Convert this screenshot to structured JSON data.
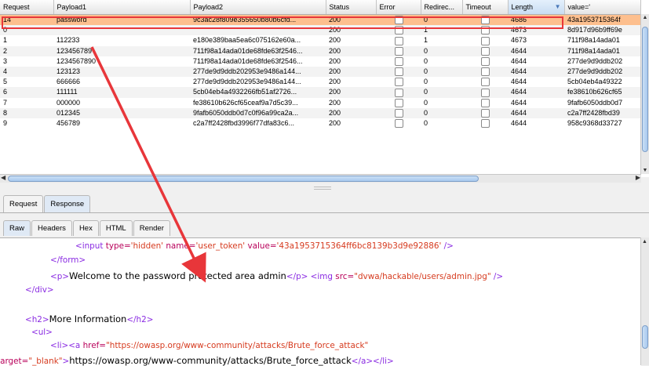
{
  "table": {
    "columns": [
      "Request",
      "Payload1",
      "Payload2",
      "Status",
      "Error",
      "Redirec...",
      "Timeout",
      "Length",
      "value='"
    ],
    "sorted_column": "Length",
    "rows": [
      {
        "request": "14",
        "payload1": "password",
        "payload2": "9c3ac28f809e355650b80b6cfd...",
        "status": "200",
        "redirect": "0",
        "length": "4686",
        "value": "43a1953715364f",
        "selected": true
      },
      {
        "request": "0",
        "payload1": "",
        "payload2": "",
        "status": "200",
        "redirect": "1",
        "length": "4673",
        "value": "8d917d96b9ff69e",
        "selected": false
      },
      {
        "request": "1",
        "payload1": "112233",
        "payload2": "e180e389baa5ea6c075162e60a...",
        "status": "200",
        "redirect": "1",
        "length": "4673",
        "value": "711f98a14ada01",
        "selected": false
      },
      {
        "request": "2",
        "payload1": "123456789",
        "payload2": "711f98a14ada01de68fde63f2546...",
        "status": "200",
        "redirect": "0",
        "length": "4644",
        "value": "711f98a14ada01",
        "selected": false
      },
      {
        "request": "3",
        "payload1": "1234567890",
        "payload2": "711f98a14ada01de68fde63f2546...",
        "status": "200",
        "redirect": "0",
        "length": "4644",
        "value": "277de9d9ddb202",
        "selected": false
      },
      {
        "request": "4",
        "payload1": "123123",
        "payload2": "277de9d9ddb202953e9486a144...",
        "status": "200",
        "redirect": "0",
        "length": "4644",
        "value": "277de9d9ddb202",
        "selected": false
      },
      {
        "request": "5",
        "payload1": "666666",
        "payload2": "277de9d9ddb202953e9486a144...",
        "status": "200",
        "redirect": "0",
        "length": "4644",
        "value": "5cb04eb4a49322",
        "selected": false
      },
      {
        "request": "6",
        "payload1": "111111",
        "payload2": "5cb04eb4a4932266fb51af2726...",
        "status": "200",
        "redirect": "0",
        "length": "4644",
        "value": "fe38610b626cf65",
        "selected": false
      },
      {
        "request": "7",
        "payload1": "000000",
        "payload2": "fe38610b626cf65ceaf9a7d5c39...",
        "status": "200",
        "redirect": "0",
        "length": "4644",
        "value": "9fafb6050ddb0d7",
        "selected": false
      },
      {
        "request": "8",
        "payload1": "012345",
        "payload2": "9fafb6050ddb0d7c0f96a99ca2a...",
        "status": "200",
        "redirect": "0",
        "length": "4644",
        "value": "c2a7ff2428fbd39",
        "selected": false
      },
      {
        "request": "9",
        "payload1": "456789",
        "payload2": "c2a7ff2428fbd3996f77dfa83c6...",
        "status": "200",
        "redirect": "0",
        "length": "4644",
        "value": "958c9368d33727",
        "selected": false
      }
    ]
  },
  "tabs_top": [
    "Request",
    "Response"
  ],
  "tabs_sub": [
    "Raw",
    "Headers",
    "Hex",
    "HTML",
    "Render"
  ],
  "code": {
    "l1": {
      "open": "<input ",
      "a1": "type=",
      "v1": "'hidden'",
      "a2": " name=",
      "v2": "'user_token'",
      "a3": " value=",
      "v3": "'43a1953715364ff6bc8139b3d9e92886'",
      "close": " />"
    },
    "l2": {
      "tag": "</form>"
    },
    "l3": {
      "open": "<p>",
      "text": "Welcome to the password protected area admin",
      "close": "</p>",
      "img_open": " <img ",
      "img_attr": "src=",
      "img_val": "\"dvwa/hackable/users/admin.jpg\"",
      "img_close": " />"
    },
    "l4": {
      "tag": "</div>"
    },
    "l5": {
      "open": "<h2>",
      "text": "More Information",
      "close": "</h2>"
    },
    "l6": {
      "tag": "<ul>"
    },
    "l7": {
      "open": "<li>",
      "a_open": "<a ",
      "attr": "href=",
      "val": "\"https://owasp.org/www-community/attacks/Brute_force_attack\""
    },
    "l8": {
      "attr": "target=",
      "val": "\"_blank\"",
      "gt": ">",
      "text": "https://owasp.org/www-community/attacks/Brute_force_attack",
      "close": "</a></li>"
    }
  },
  "colors": {
    "selected_row": "#fdbf8e",
    "highlight": "#e8363a",
    "tag": "#8a2be2",
    "attr": "#b8005a",
    "value": "#d63b1f"
  }
}
